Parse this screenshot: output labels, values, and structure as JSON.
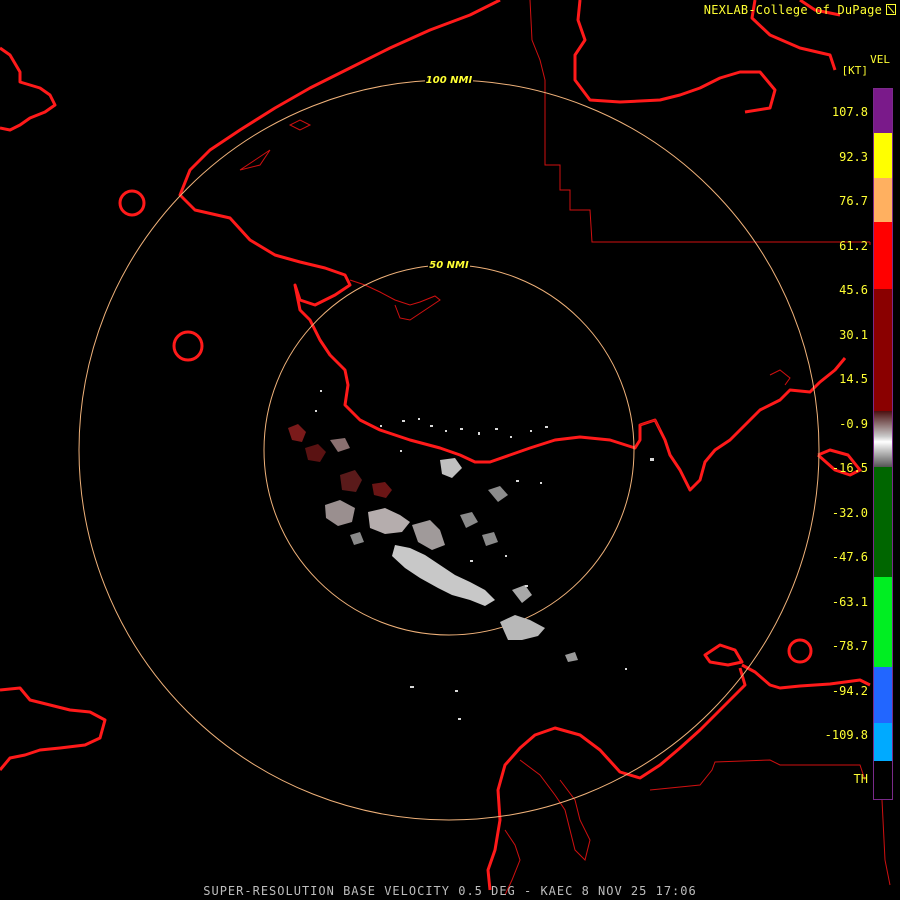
{
  "credit": "NEXLAB-College of DuPage",
  "legend": {
    "product": "VEL",
    "unit": "[KT]",
    "scale_labels": [
      "107.8",
      "92.3",
      "76.7",
      "61.2",
      "45.6",
      "30.1",
      "14.5",
      "-0.9",
      "-16.5",
      "-32.0",
      "-47.6",
      "-63.1",
      "-78.7",
      "-94.2",
      "-109.8"
    ],
    "th_label": "TH",
    "colors": {
      "purple": "#7a1a8a",
      "yellow": "#ffff00",
      "orange": "#ffb060",
      "red": "#ff0000",
      "dark_red": "#8a0000",
      "gray": "#c8c8c8",
      "dark_green": "#006600",
      "green": "#00ee22",
      "blue": "#2266ff",
      "light_blue": "#00aaff"
    }
  },
  "range_rings": [
    "100 NMI",
    "50 NMI"
  ],
  "footer": "SUPER-RESOLUTION BASE VELOCITY 0.5 DEG - KAEC 8 NOV 25 17:06"
}
